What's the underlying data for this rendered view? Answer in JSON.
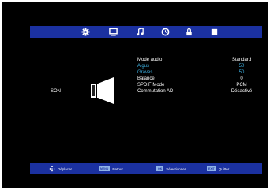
{
  "menu_tabs": [
    {
      "icon": "gear-icon"
    },
    {
      "icon": "monitor-icon"
    },
    {
      "icon": "music-note-icon"
    },
    {
      "icon": "clock-icon"
    },
    {
      "icon": "lock-icon"
    },
    {
      "icon": "square-icon"
    }
  ],
  "section_label": "SON",
  "settings": [
    {
      "label": "Mode audio",
      "value": "Standard",
      "highlight": false
    },
    {
      "label": "Aigus",
      "value": "50",
      "highlight": true
    },
    {
      "label": "Graves",
      "value": "50",
      "highlight": true
    },
    {
      "label": "Balance",
      "value": "0",
      "highlight": false
    },
    {
      "label": "SPDIF Mode",
      "value": "PCM",
      "highlight": false
    },
    {
      "label": "Commutation AD",
      "value": "Désactivé",
      "highlight": false
    }
  ],
  "footer": {
    "move_label": "Déplacer",
    "menu_key": "MENU",
    "back_label": "Retour",
    "ok_key": "OK",
    "select_label": "Sélectionner",
    "exit_key": "EXIT",
    "exit_label": "Quitter"
  },
  "colors": {
    "bar": "#1b31a0",
    "highlight": "#3fb6e8",
    "background": "#000000"
  }
}
